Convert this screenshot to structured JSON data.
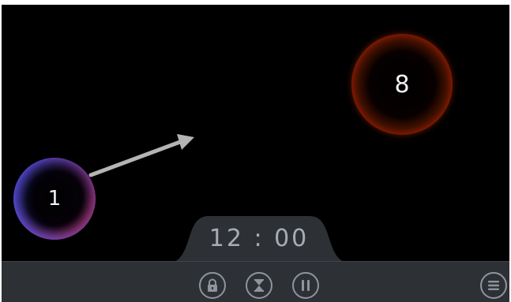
{
  "balls": [
    {
      "label": "1",
      "color": "#d63868"
    },
    {
      "label": "8",
      "color": "#ff5a10"
    }
  ],
  "timer": {
    "value": "12 : 00"
  },
  "controls": {
    "lock_icon": "lock-icon",
    "timer_icon": "hourglass-icon",
    "pause_icon": "pause-icon",
    "menu_icon": "menu-icon"
  },
  "colors": {
    "background": "#000000",
    "bar": "#2d3136",
    "icon": "#8e959c",
    "timer_text": "#a7adb3",
    "arrow": "#b4b4b4"
  }
}
